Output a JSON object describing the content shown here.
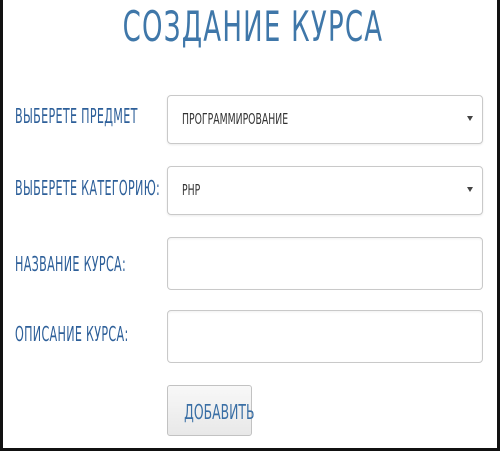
{
  "title": "СОЗДАНИЕ КУРСА",
  "form": {
    "subject_label": "ВЫБЕРЕТЕ ПРЕДМЕТ",
    "subject_value": "ПРОГРАММИРОВАНИЕ",
    "category_label": "ВЫБЕРЕТЕ КАТЕГОРИЮ:",
    "category_value": "PHP",
    "course_name_label": "НАЗВАНИЕ КУРСА:",
    "course_name_value": "",
    "course_desc_label": "ОПИСАНИЕ КУРСА:",
    "course_desc_value": "",
    "submit_label": "ДОБАВИТЬ"
  },
  "colors": {
    "accent": "#3f77a9",
    "border": "#111111"
  }
}
